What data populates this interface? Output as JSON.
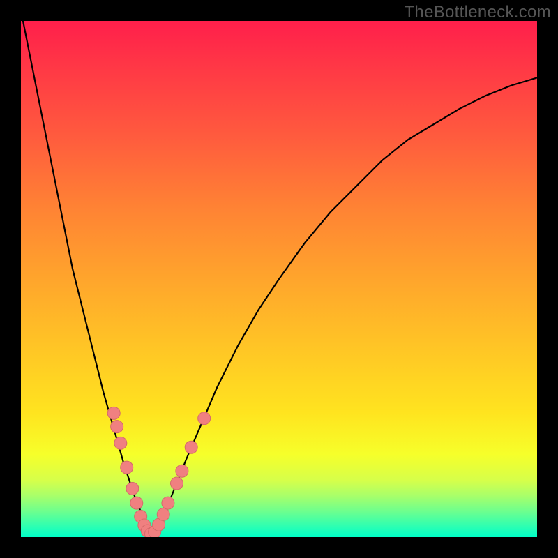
{
  "watermark": "TheBottleneck.com",
  "colors": {
    "curve": "#000000",
    "marker_fill": "#f08080",
    "marker_stroke": "#d46a6a",
    "gradient_top": "#ff1f4b",
    "gradient_bottom": "#00ffc8"
  },
  "chart_data": {
    "type": "line",
    "title": "",
    "xlabel": "",
    "ylabel": "",
    "xlim": [
      0,
      100
    ],
    "ylim": [
      0,
      100
    ],
    "grid": false,
    "series": [
      {
        "name": "bottleneck-curve",
        "note": "V-shaped curve; y≈0 near x≈25, rises toward both x extremes",
        "x": [
          0,
          2,
          4,
          6,
          8,
          10,
          12,
          14,
          16,
          18,
          20,
          22,
          24,
          25,
          26,
          28,
          30,
          32,
          35,
          38,
          42,
          46,
          50,
          55,
          60,
          65,
          70,
          75,
          80,
          85,
          90,
          95,
          100
        ],
        "y": [
          102,
          92,
          82,
          72,
          62,
          52,
          44,
          36,
          28,
          21,
          14,
          8,
          3,
          0.5,
          1.5,
          5,
          10,
          15,
          22,
          29,
          37,
          44,
          50,
          57,
          63,
          68,
          73,
          77,
          80,
          83,
          85.5,
          87.5,
          89
        ]
      }
    ],
    "markers": {
      "name": "highlighted-points",
      "note": "pink dots clustered near the minimum of the curve",
      "points": [
        {
          "x": 18.0,
          "y": 24.0
        },
        {
          "x": 18.6,
          "y": 21.4
        },
        {
          "x": 19.3,
          "y": 18.2
        },
        {
          "x": 20.5,
          "y": 13.5
        },
        {
          "x": 21.6,
          "y": 9.4
        },
        {
          "x": 22.4,
          "y": 6.6
        },
        {
          "x": 23.2,
          "y": 4.0
        },
        {
          "x": 23.9,
          "y": 2.3
        },
        {
          "x": 24.5,
          "y": 1.2
        },
        {
          "x": 25.2,
          "y": 0.6
        },
        {
          "x": 25.9,
          "y": 1.0
        },
        {
          "x": 26.7,
          "y": 2.4
        },
        {
          "x": 27.6,
          "y": 4.4
        },
        {
          "x": 28.5,
          "y": 6.6
        },
        {
          "x": 30.2,
          "y": 10.4
        },
        {
          "x": 31.2,
          "y": 12.8
        },
        {
          "x": 33.0,
          "y": 17.4
        },
        {
          "x": 35.5,
          "y": 23.0
        }
      ]
    }
  }
}
